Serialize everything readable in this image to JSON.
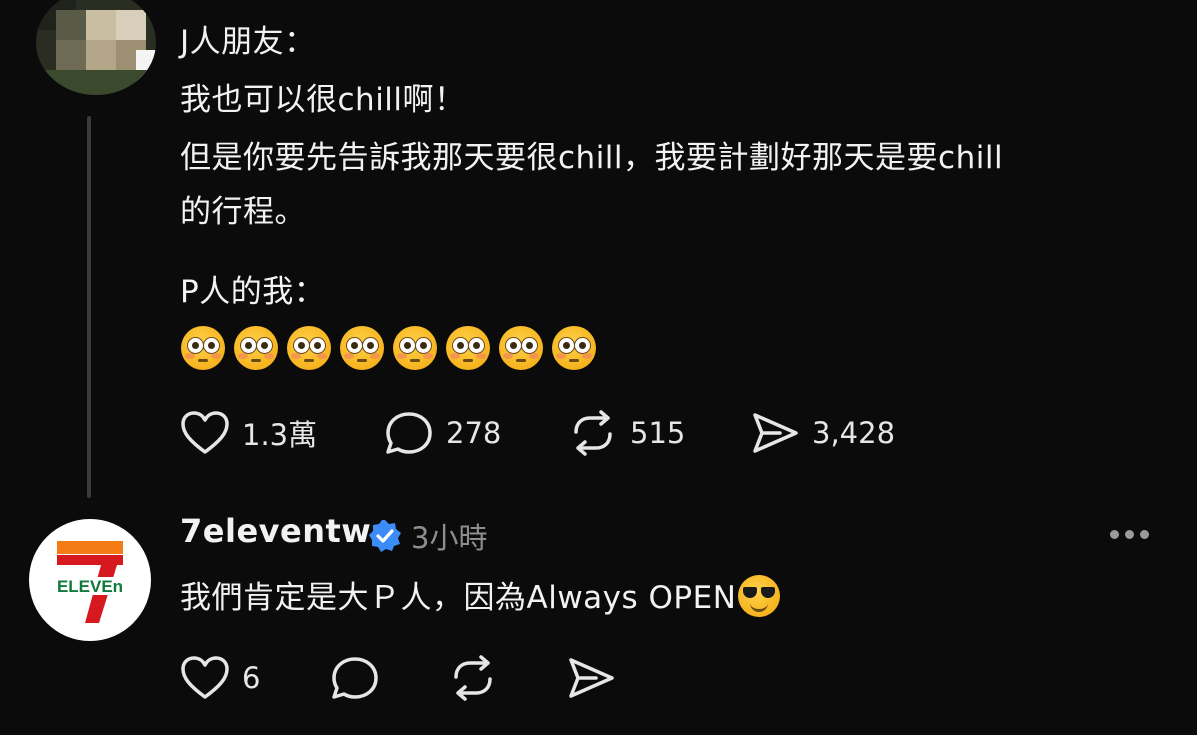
{
  "post1": {
    "lines": [
      "J人朋友：",
      "我也可以很chill啊！",
      "但是你要先告訴我那天要很chill，我要計劃好那天是要chill",
      "的行程。",
      "P人的我："
    ],
    "emoji_name": "flushed-face-emoji",
    "emoji_count": 8,
    "actions": {
      "likes": "1.3萬",
      "replies": "278",
      "reposts": "515",
      "shares": "3,428"
    }
  },
  "post2": {
    "username": "7eleventw",
    "timestamp": "3小時",
    "avatar_text": "ELEVEn",
    "text": "我們肯定是大Ｐ人，因為Always OPEN",
    "emoji_name": "smiling-face-with-sunglasses-emoji",
    "actions": {
      "likes": "6"
    }
  },
  "colors": {
    "background": "#0b0b0b",
    "text": "#f2f2f2",
    "muted": "#8e8e8e",
    "verified": "#3b8cf6",
    "seven_orange": "#f57c14",
    "seven_red": "#d6181f",
    "seven_green": "#0f7a3c"
  }
}
